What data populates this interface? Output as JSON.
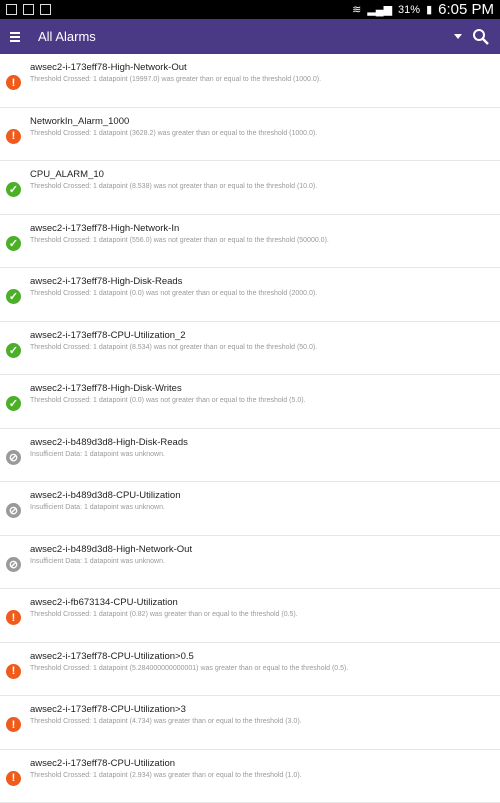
{
  "status_bar": {
    "battery": "31%",
    "time": "6:05 PM"
  },
  "app_bar": {
    "title": "All Alarms"
  },
  "alarms": [
    {
      "name": "awsec2-i-173eff78-High-Network-Out",
      "description": "Threshold Crossed: 1 datapoint (19997.0) was greater than or equal to the threshold (1000.0).",
      "state": "alarm"
    },
    {
      "name": "NetworkIn_Alarm_1000",
      "description": "Threshold Crossed: 1 datapoint (3628.2) was greater than or equal to the threshold (1000.0).",
      "state": "alarm"
    },
    {
      "name": "CPU_ALARM_10",
      "description": "Threshold Crossed: 1 datapoint (8.538) was not greater than or equal to the threshold (10.0).",
      "state": "ok"
    },
    {
      "name": "awsec2-i-173eff78-High-Network-In",
      "description": "Threshold Crossed: 1 datapoint (556.0) was not greater than or equal to the threshold (50000.0).",
      "state": "ok"
    },
    {
      "name": "awsec2-i-173eff78-High-Disk-Reads",
      "description": "Threshold Crossed: 1 datapoint (0.0) was not greater than or equal to the threshold (2000.0).",
      "state": "ok"
    },
    {
      "name": "awsec2-i-173eff78-CPU-Utilization_2",
      "description": "Threshold Crossed: 1 datapoint (8.534) was not greater than or equal to the threshold (50.0).",
      "state": "ok"
    },
    {
      "name": "awsec2-i-173eff78-High-Disk-Writes",
      "description": "Threshold Crossed: 1 datapoint (0.0) was not greater than or equal to the threshold (5.0).",
      "state": "ok"
    },
    {
      "name": "awsec2-i-b489d3d8-High-Disk-Reads",
      "description": "Insufficient Data: 1 datapoint was unknown.",
      "state": "insufficient"
    },
    {
      "name": "awsec2-i-b489d3d8-CPU-Utilization",
      "description": "Insufficient Data: 1 datapoint was unknown.",
      "state": "insufficient"
    },
    {
      "name": "awsec2-i-b489d3d8-High-Network-Out",
      "description": "Insufficient Data: 1 datapoint was unknown.",
      "state": "insufficient"
    },
    {
      "name": "awsec2-i-fb673134-CPU-Utilization",
      "description": "Threshold Crossed: 1 datapoint (0.82) was greater than or equal to the threshold (0.5).",
      "state": "alarm"
    },
    {
      "name": "awsec2-i-173eff78-CPU-Utilization>0.5",
      "description": "Threshold Crossed: 1 datapoint (5.284000000000001) was greater than or equal to the threshold (0.5).",
      "state": "alarm"
    },
    {
      "name": "awsec2-i-173eff78-CPU-Utilization>3",
      "description": "Threshold Crossed: 1 datapoint (4.734) was greater than or equal to the threshold (3.0).",
      "state": "alarm"
    },
    {
      "name": "awsec2-i-173eff78-CPU-Utilization",
      "description": "Threshold Crossed: 1 datapoint (2.934) was greater than or equal to the threshold (1.0).",
      "state": "alarm"
    }
  ]
}
